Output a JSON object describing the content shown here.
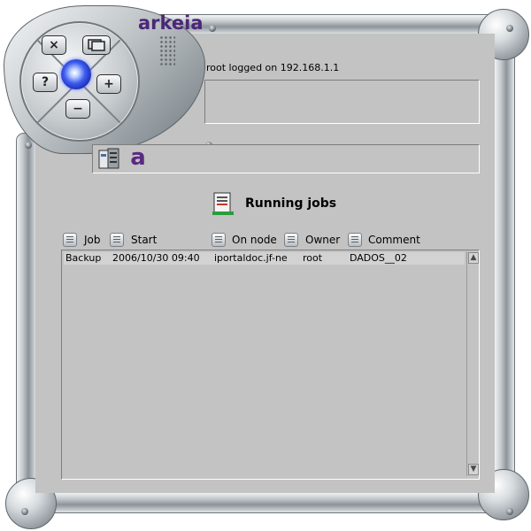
{
  "window": {
    "brand": "arkeia",
    "controls": {
      "close_label": "×",
      "window_label": "",
      "help_label": "?",
      "add_label": "+",
      "remove_label": "−"
    }
  },
  "session": {
    "login_text": "root logged on 192.168.1.1"
  },
  "logo_bar": {
    "app_letter": "a"
  },
  "jobs": {
    "title": "Running jobs",
    "columns": [
      "Job",
      "Start",
      "On node",
      "Owner",
      "Comment"
    ],
    "rows": [
      {
        "job": "Backup",
        "start": "2006/10/30 09:40",
        "on_node": "iportaldoc.jf-ne",
        "owner": "root",
        "comment": "DADOS__02"
      }
    ]
  },
  "icons": {
    "server": "server-icon",
    "app": "arkeia-a-icon",
    "jobs": "running-jobs-icon",
    "column": "column-header-icon",
    "scroll_up": "▲",
    "scroll_down": "▼"
  },
  "colors": {
    "panel": "#c3c3c3",
    "brand": "#4b2778",
    "orb": "#3e5cf0"
  }
}
